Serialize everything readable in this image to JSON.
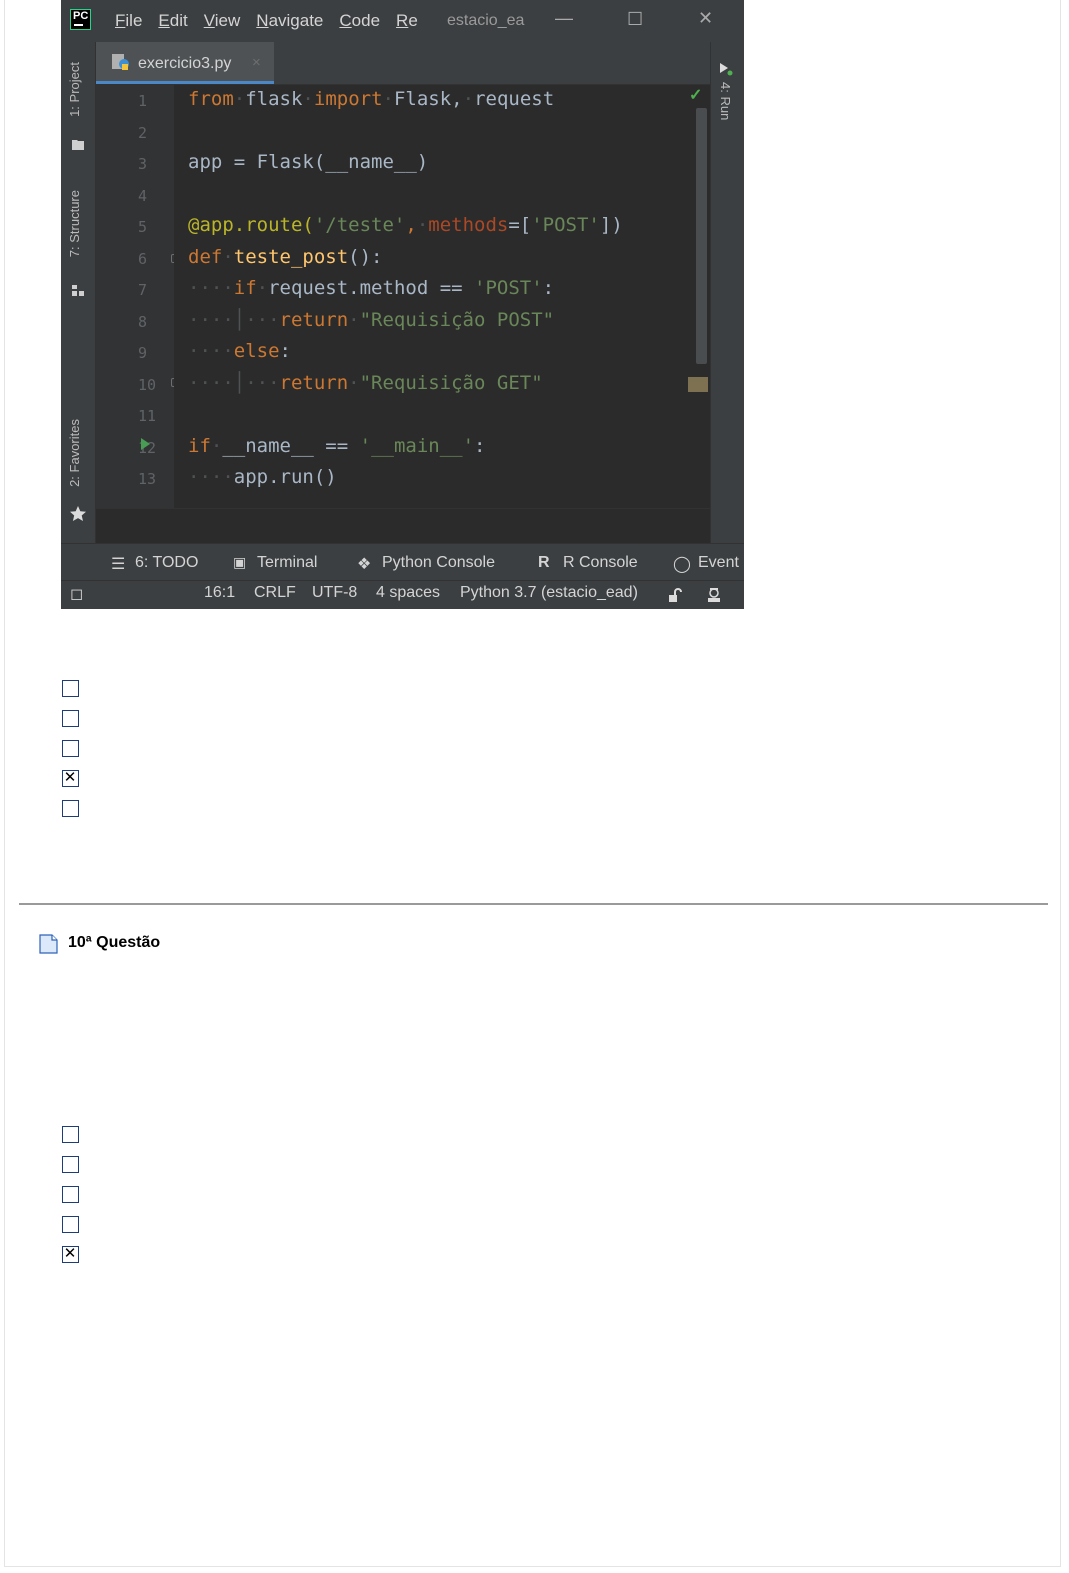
{
  "ide": {
    "logo": "PC",
    "menu": [
      "File",
      "Edit",
      "View",
      "Navigate",
      "Code",
      "Re"
    ],
    "window_title": "estacio_ea",
    "window_controls": {
      "minimize": "—",
      "maximize": "☐",
      "close": "✕"
    },
    "left_tool_tabs": [
      "1: Project",
      "7: Structure",
      "2: Favorites"
    ],
    "right_tool_tab": "4: Run",
    "file_tab": {
      "name": "exercicio3.py",
      "close": "×"
    },
    "line_numbers": [
      "1",
      "2",
      "3",
      "4",
      "5",
      "6",
      "7",
      "8",
      "9",
      "10",
      "11",
      "12",
      "13"
    ],
    "code": {
      "l1": {
        "kw1": "from",
        "mod": "flask",
        "kw2": "import",
        "names": "Flask,",
        "req": "request"
      },
      "l3": {
        "text": "app = Flask(__name__)"
      },
      "l5": {
        "deco": "@app.route(",
        "path": "'/teste'",
        "comma": ",",
        "param": "methods",
        "eq": "=[",
        "val": "'POST'",
        "close": "])"
      },
      "l6": {
        "kw": "def",
        "fn": "teste_post",
        "rest": "():"
      },
      "l7": {
        "kw": "if",
        "expr": "request.method == ",
        "str": "'POST'",
        "colon": ":"
      },
      "l8": {
        "kw": "return",
        "str": "\"Requisição POST\""
      },
      "l9": {
        "kw": "else",
        "colon": ":"
      },
      "l10": {
        "kw": "return",
        "str": "\"Requisição GET\""
      },
      "l12": {
        "kw": "if",
        "expr": "__name__ == ",
        "str": "'__main__'",
        "colon": ":"
      },
      "l13": {
        "text": "app.run()"
      }
    },
    "tool_windows": [
      "6: TODO",
      "Terminal",
      "Python Console",
      "R Console",
      "Event"
    ],
    "status": {
      "position": "16:1",
      "line_sep": "CRLF",
      "encoding": "UTF-8",
      "indent": "4 spaces",
      "interpreter": "Python 3.7 (estacio_ead)"
    }
  },
  "question9_options_checked": [
    false,
    false,
    false,
    true,
    false
  ],
  "question10": {
    "title": "10ª Questão",
    "options_checked": [
      false,
      false,
      false,
      false,
      true
    ]
  },
  "check_mark": "✕",
  "colors": {
    "ide_bg": "#3c3f41",
    "editor_bg": "#2b2b2b",
    "keyword": "#cc7832",
    "string": "#6a8759",
    "checkbox_border": "#1d3d7a"
  }
}
